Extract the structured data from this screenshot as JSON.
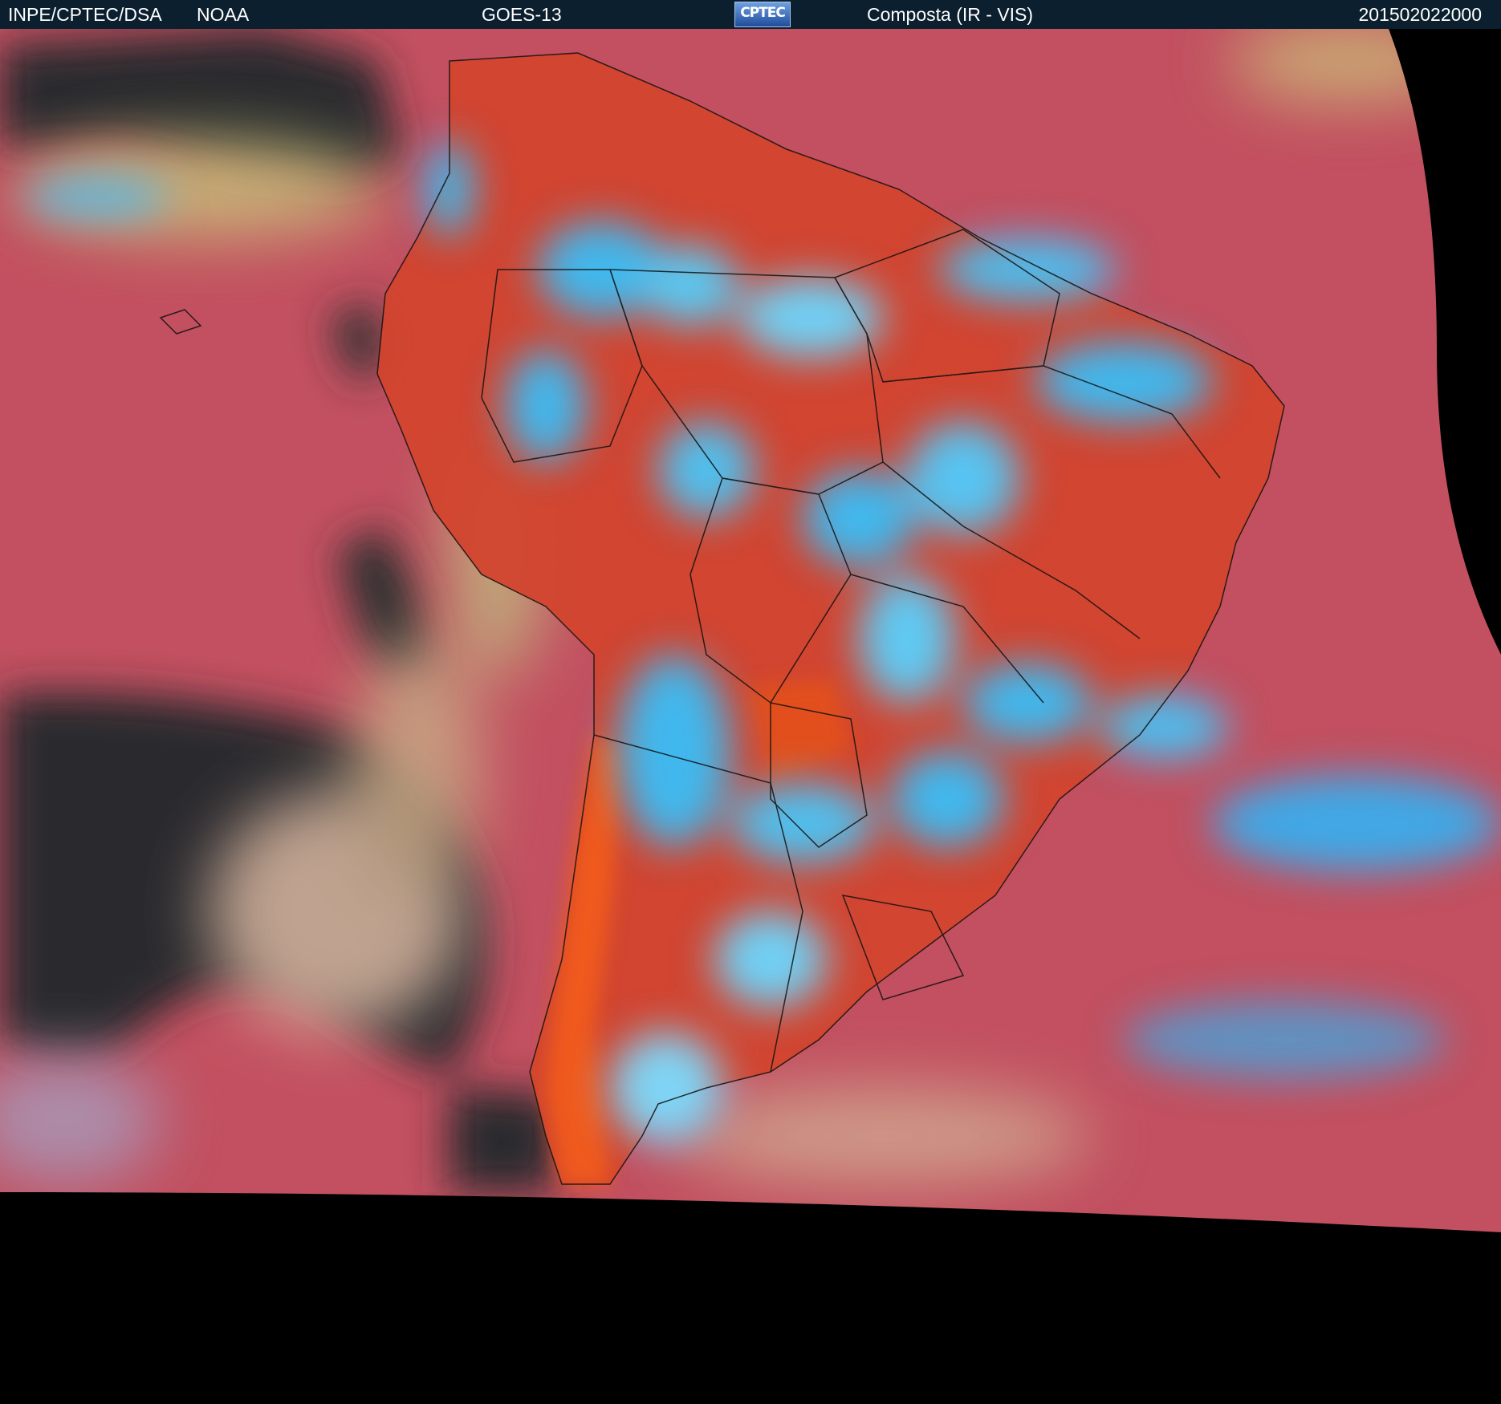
{
  "header": {
    "organization": "INPE/CPTEC/DSA",
    "agency": "NOAA",
    "satellite": "GOES-13",
    "logo_text": "CPTEC",
    "product": "Composta (IR - VIS)",
    "datetime": "201502022000"
  },
  "colors": {
    "header_bg": "#0b1f2e",
    "ocean_clear": "#c25060",
    "land_clear": "#d2452e",
    "cold_cloud": "#3fb8ee",
    "low_cloud": "#c8c27a",
    "dark_cloud_free": "#2e2e30",
    "background": "#000000"
  },
  "map": {
    "icons": [
      "continent-outline",
      "country-borders",
      "state-borders"
    ]
  }
}
